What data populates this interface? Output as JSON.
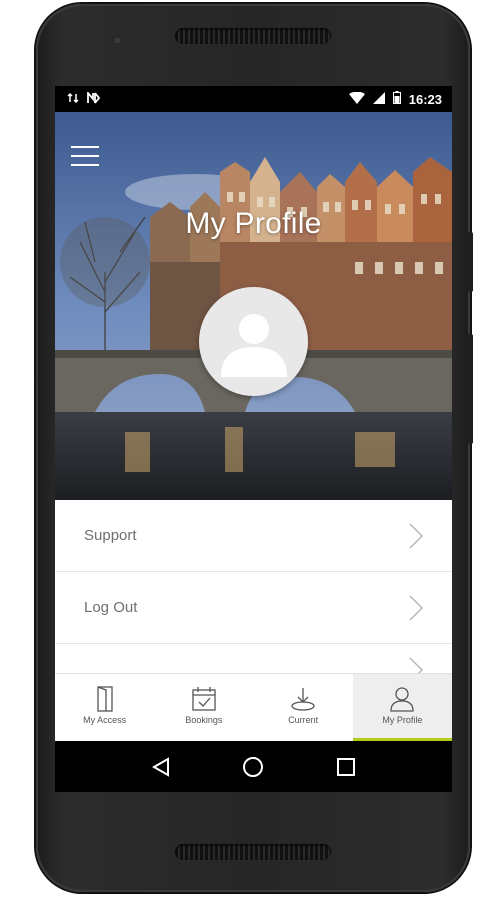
{
  "status_bar": {
    "time": "16:23",
    "left_icons": [
      "data-transfer-icon",
      "nfc-icon"
    ],
    "right_icons": [
      "wifi-icon",
      "cell-signal-icon",
      "battery-icon"
    ]
  },
  "header": {
    "title": "My Profile",
    "menu_icon": "hamburger-menu-icon"
  },
  "profile": {
    "avatar_icon": "user-placeholder-icon"
  },
  "menu_list": [
    {
      "label": "Support",
      "icon": "chevron-right-icon"
    },
    {
      "label": "Log Out",
      "icon": "chevron-right-icon"
    },
    {
      "label": "",
      "icon": "chevron-right-icon"
    }
  ],
  "bottom_nav": {
    "items": [
      {
        "label": "My Access",
        "icon": "door-icon"
      },
      {
        "label": "Bookings",
        "icon": "calendar-check-icon"
      },
      {
        "label": "Current",
        "icon": "download-tray-icon"
      },
      {
        "label": "My Profile",
        "icon": "person-icon"
      }
    ],
    "active_label": "My Profile",
    "accent_color": "#b5cc18"
  },
  "system_nav": {
    "icons": [
      "back-triangle-icon",
      "home-circle-icon",
      "recents-square-icon"
    ]
  }
}
